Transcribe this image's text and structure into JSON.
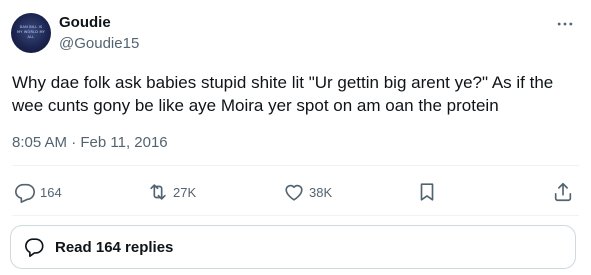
{
  "author": {
    "display_name": "Goudie",
    "handle": "@Goudie15",
    "avatar_lines": [
      "DAN BILL IS",
      "MY WORLD MY",
      "ALL"
    ]
  },
  "tweet": {
    "text": "Why dae folk ask babies stupid shite lit \"Ur gettin big arent ye?\" As if the wee cunts gony be like aye Moira yer spot on am oan the protein",
    "timestamp": "8:05 AM · Feb 11, 2016"
  },
  "actions": {
    "reply_count": "164",
    "retweet_count": "27K",
    "like_count": "38K"
  },
  "replies": {
    "label": "Read 164 replies"
  },
  "icons": {
    "more": "more-horizontal-icon",
    "reply": "reply-icon",
    "retweet": "retweet-icon",
    "like": "heart-icon",
    "bookmark": "bookmark-icon",
    "share": "share-icon",
    "replies": "chat-bubble-icon"
  },
  "colors": {
    "text": "#0f1419",
    "secondary": "#536471",
    "border": "#cfd9de"
  }
}
